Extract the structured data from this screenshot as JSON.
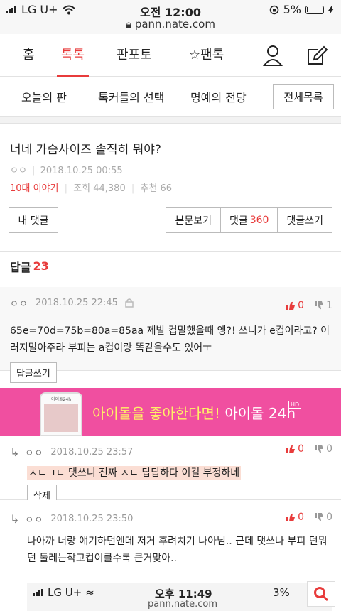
{
  "status": {
    "carrier": "LG U+",
    "time": "오전 12:00",
    "battery": "5%",
    "url": "pann.nate.com"
  },
  "nav1": {
    "tabs": [
      "홈",
      "톡톡",
      "판포토",
      "팬톡"
    ],
    "active_index": 1,
    "star_icon": "star-icon"
  },
  "nav2": {
    "items": [
      "오늘의 판",
      "톡커들의 선택",
      "명예의 전당"
    ],
    "all_button": "전체목록"
  },
  "post": {
    "title": "너네 가슴사이즈 솔직히 뭐야?",
    "author": "ㅇㅇ",
    "date": "2018.10.25 00:55",
    "category": "10대 이야기",
    "views": "조회 44,380",
    "recommend": "추천 66"
  },
  "buttons": {
    "my_comment": "내 댓글",
    "view_body": "본문보기",
    "comments_label": "댓글",
    "comments_count": "360",
    "write_comment": "댓글쓰기"
  },
  "replies": {
    "label": "답글",
    "count": "23"
  },
  "comments": [
    {
      "user": "ㅇㅇ",
      "date": "2018.10.25 22:45",
      "up": "0",
      "down": "1",
      "body": "65e=70d=75b=80a=85aa 제발 컵말했을때 엥?! 쓰니가 e컵이라고? 이러지말아주라 부피는 a컵이랑 똑같을수도 있어ㅜ",
      "button": "답글쓰기"
    },
    {
      "user": "ㅇㅇ",
      "date": "2018.10.25 23:57",
      "up": "0",
      "down": "0",
      "body": "ㅈㄴㄱㄷ 댓쓰니 진짜 ㅈㄴ 답답하다 이걸 부정하네",
      "button": "삭제"
    },
    {
      "user": "ㅇㅇ",
      "date": "2018.10.25 23:50",
      "up": "0",
      "down": "0",
      "body": "나아까 너랑 얘기하던앤데 저거 후려치기 나아님.. 근데 댓쓰나 부피 던뭐던 둘레는작고컵이클수록 큰거맞아.."
    }
  ],
  "ad": {
    "text_highlight": "아이돌을 좋아한다면!",
    "text_main": "아이돌 24h",
    "badge": "HD",
    "phone_label": "아이돌24h"
  },
  "bottom_shot": {
    "carrier": "LG U+",
    "time": "오후 11:49",
    "battery": "3%",
    "url": "pann.nate.com"
  },
  "colors": {
    "accent": "#e83b3b",
    "ad_bg": "#f04fa0"
  }
}
